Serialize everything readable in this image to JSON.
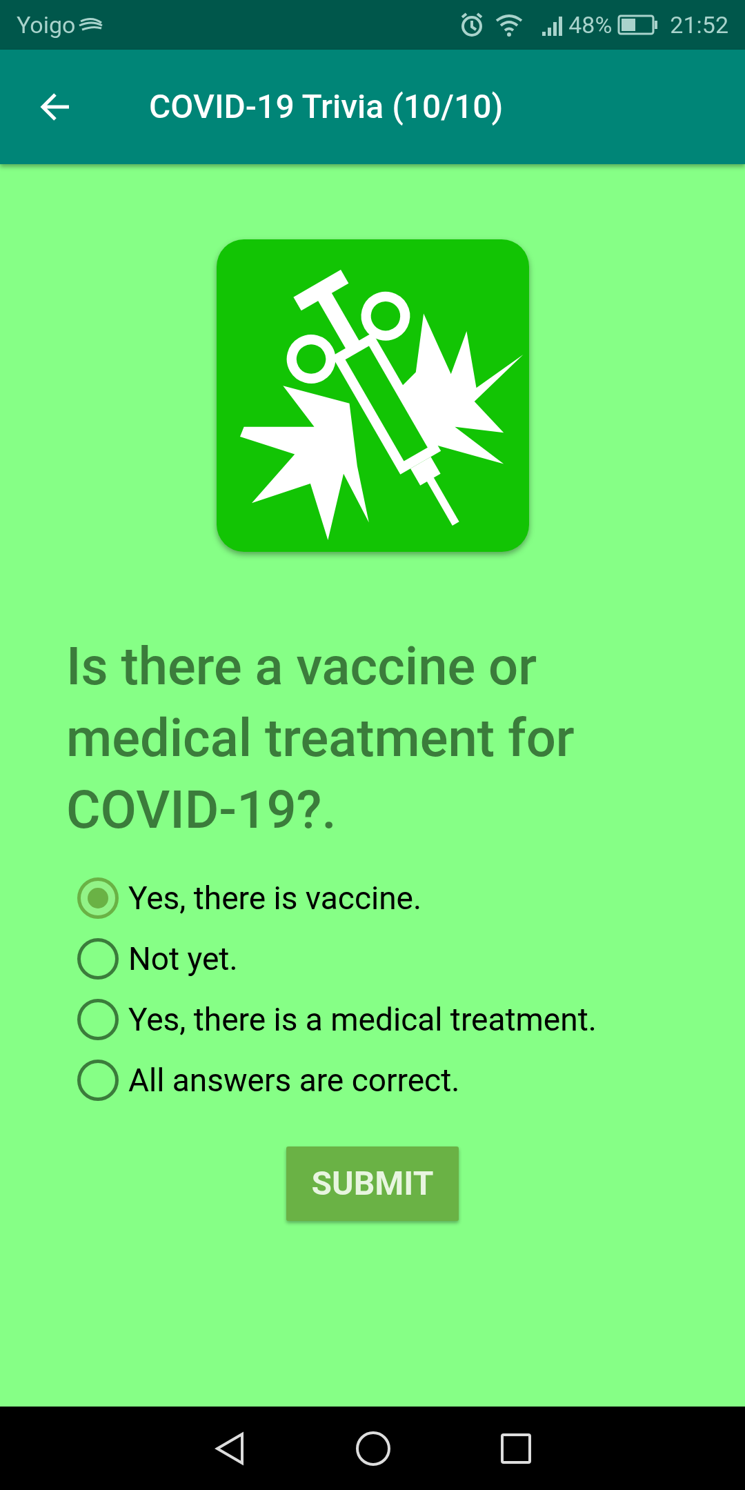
{
  "status_bar": {
    "carrier": "Yoigo",
    "battery": "48%",
    "time": "21:52"
  },
  "app_bar": {
    "title": "COVID-19 Trivia (10/10)"
  },
  "question": "Is there a vaccine or medical treatment for COVID-19?.",
  "options": [
    {
      "label": "Yes, there is vaccine.",
      "selected": true
    },
    {
      "label": "Not yet.",
      "selected": false
    },
    {
      "label": "Yes, there is a medical treatment.",
      "selected": false
    },
    {
      "label": "All answers are correct.",
      "selected": false
    }
  ],
  "submit": "SUBMIT"
}
